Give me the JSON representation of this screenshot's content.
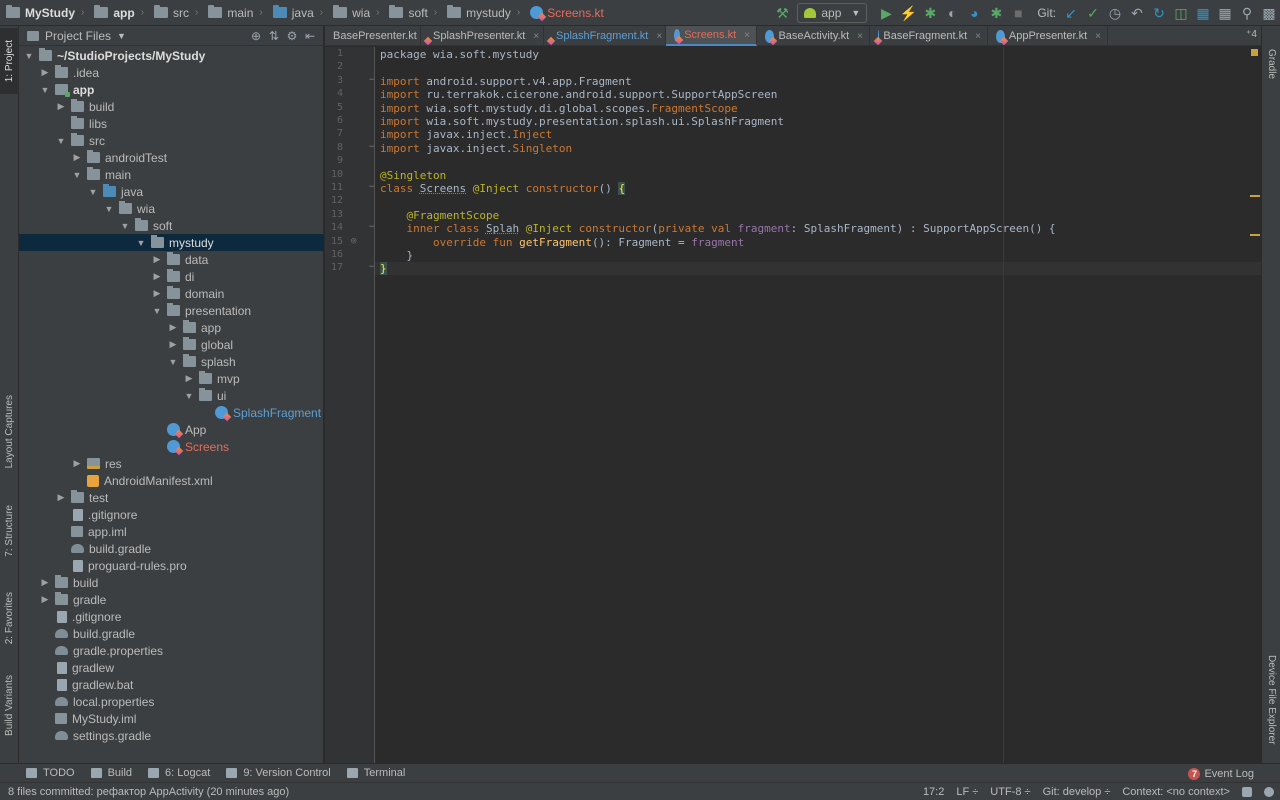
{
  "breadcrumb": [
    {
      "label": "MyStudy",
      "bold": true,
      "icon": "folder-icon"
    },
    {
      "label": "app",
      "bold": true,
      "icon": "module-folder-icon"
    },
    {
      "label": "src",
      "icon": "folder-icon"
    },
    {
      "label": "main",
      "icon": "folder-icon"
    },
    {
      "label": "java",
      "icon": "source-folder-icon"
    },
    {
      "label": "wia",
      "icon": "package-icon"
    },
    {
      "label": "soft",
      "icon": "package-icon"
    },
    {
      "label": "mystudy",
      "icon": "package-icon"
    },
    {
      "label": "Screens.kt",
      "icon": "kotlin-file-icon",
      "red": true
    }
  ],
  "toolbar": {
    "run_config": "app",
    "git_label": "Git:",
    "icons": [
      "hammer-icon",
      "run-icon",
      "lightning-icon",
      "debug-icon",
      "coverage-icon",
      "profile-icon",
      "attach-debugger-icon",
      "stop-icon",
      "git-update-icon",
      "git-commit-icon",
      "history-icon",
      "revert-icon",
      "gradle-sync-icon",
      "avd-manager-icon",
      "sdk-manager-icon",
      "project-structure-icon",
      "search-icon",
      "terminal-icon"
    ]
  },
  "left_strip": {
    "project": "1: Project",
    "layout_captures": "Layout Captures",
    "structure": "7: Structure",
    "favorites": "2: Favorites",
    "build_variants": "Build Variants"
  },
  "right_strip": {
    "gradle": "Gradle",
    "device_file_explorer": "Device File Explorer"
  },
  "project_panel": {
    "title": "Project Files",
    "tree": [
      {
        "depth": 0,
        "label": "~/StudioProjects/MyStudy",
        "arrow": "open",
        "icon": "folder",
        "style": "bold"
      },
      {
        "depth": 1,
        "label": ".idea",
        "arrow": "closed",
        "icon": "folder"
      },
      {
        "depth": 1,
        "label": "app",
        "arrow": "open",
        "icon": "folder-module",
        "style": "bold"
      },
      {
        "depth": 2,
        "label": "build",
        "arrow": "closed",
        "icon": "folder"
      },
      {
        "depth": 2,
        "label": "libs",
        "arrow": "none",
        "icon": "folder"
      },
      {
        "depth": 2,
        "label": "src",
        "arrow": "open",
        "icon": "folder"
      },
      {
        "depth": 3,
        "label": "androidTest",
        "arrow": "closed",
        "icon": "folder"
      },
      {
        "depth": 3,
        "label": "main",
        "arrow": "open",
        "icon": "folder"
      },
      {
        "depth": 4,
        "label": "java",
        "arrow": "open",
        "icon": "folder-blue"
      },
      {
        "depth": 5,
        "label": "wia",
        "arrow": "open",
        "icon": "folder"
      },
      {
        "depth": 6,
        "label": "soft",
        "arrow": "open",
        "icon": "folder"
      },
      {
        "depth": 7,
        "label": "mystudy",
        "arrow": "open",
        "icon": "folder",
        "selected": true,
        "style": "white"
      },
      {
        "depth": 8,
        "label": "data",
        "arrow": "closed",
        "icon": "folder"
      },
      {
        "depth": 8,
        "label": "di",
        "arrow": "closed",
        "icon": "folder"
      },
      {
        "depth": 8,
        "label": "domain",
        "arrow": "closed",
        "icon": "folder"
      },
      {
        "depth": 8,
        "label": "presentation",
        "arrow": "open",
        "icon": "folder"
      },
      {
        "depth": 9,
        "label": "app",
        "arrow": "closed",
        "icon": "folder"
      },
      {
        "depth": 9,
        "label": "global",
        "arrow": "closed",
        "icon": "folder"
      },
      {
        "depth": 9,
        "label": "splash",
        "arrow": "open",
        "icon": "folder"
      },
      {
        "depth": 10,
        "label": "mvp",
        "arrow": "closed",
        "icon": "folder"
      },
      {
        "depth": 10,
        "label": "ui",
        "arrow": "open",
        "icon": "folder"
      },
      {
        "depth": 11,
        "label": "SplashFragment",
        "arrow": "none",
        "icon": "kt",
        "style": "blue"
      },
      {
        "depth": 8,
        "label": "App",
        "arrow": "none",
        "icon": "kt"
      },
      {
        "depth": 8,
        "label": "Screens",
        "arrow": "none",
        "icon": "kt",
        "style": "red"
      },
      {
        "depth": 3,
        "label": "res",
        "arrow": "closed",
        "icon": "folder-res"
      },
      {
        "depth": 3,
        "label": "AndroidManifest.xml",
        "arrow": "none",
        "icon": "file-xml"
      },
      {
        "depth": 2,
        "label": "test",
        "arrow": "closed",
        "icon": "folder"
      },
      {
        "depth": 2,
        "label": ".gitignore",
        "arrow": "none",
        "icon": "file"
      },
      {
        "depth": 2,
        "label": "app.iml",
        "arrow": "none",
        "icon": "file-iml"
      },
      {
        "depth": 2,
        "label": "build.gradle",
        "arrow": "none",
        "icon": "gradle"
      },
      {
        "depth": 2,
        "label": "proguard-rules.pro",
        "arrow": "none",
        "icon": "file"
      },
      {
        "depth": 1,
        "label": "build",
        "arrow": "closed",
        "icon": "folder"
      },
      {
        "depth": 1,
        "label": "gradle",
        "arrow": "closed",
        "icon": "folder"
      },
      {
        "depth": 1,
        "label": ".gitignore",
        "arrow": "none",
        "icon": "file"
      },
      {
        "depth": 1,
        "label": "build.gradle",
        "arrow": "none",
        "icon": "gradle"
      },
      {
        "depth": 1,
        "label": "gradle.properties",
        "arrow": "none",
        "icon": "gradle"
      },
      {
        "depth": 1,
        "label": "gradlew",
        "arrow": "none",
        "icon": "file"
      },
      {
        "depth": 1,
        "label": "gradlew.bat",
        "arrow": "none",
        "icon": "file"
      },
      {
        "depth": 1,
        "label": "local.properties",
        "arrow": "none",
        "icon": "gradle"
      },
      {
        "depth": 1,
        "label": "MyStudy.iml",
        "arrow": "none",
        "icon": "file-iml"
      },
      {
        "depth": 1,
        "label": "settings.gradle",
        "arrow": "none",
        "icon": "gradle"
      }
    ]
  },
  "tabs": [
    {
      "label": "BasePresenter.kt",
      "style": "normal",
      "truncated": true
    },
    {
      "label": "SplashPresenter.kt",
      "style": "normal"
    },
    {
      "label": "SplashFragment.kt",
      "style": "blue"
    },
    {
      "label": "Screens.kt",
      "style": "red",
      "active": true
    },
    {
      "label": "BaseActivity.kt",
      "style": "normal"
    },
    {
      "label": "BaseFragment.kt",
      "style": "normal"
    },
    {
      "label": "AppPresenter.kt",
      "style": "normal"
    }
  ],
  "tabs_more": "⁺4",
  "editor": {
    "line_numbers": [
      "1",
      "2",
      "3",
      "4",
      "5",
      "6",
      "7",
      "8",
      "9",
      "10",
      "11",
      "12",
      "13",
      "14",
      "15",
      "16",
      "17"
    ],
    "lines": [
      [
        {
          "t": "package wia.soft.mystudy",
          "c": "cls"
        }
      ],
      [],
      [
        {
          "t": "import",
          "c": "kw"
        },
        {
          "t": " android.support.v4.app.Fragment",
          "c": "cls"
        }
      ],
      [
        {
          "t": "import",
          "c": "kw"
        },
        {
          "t": " ru.terrakok.cicerone.android.support.SupportAppScreen",
          "c": "cls"
        }
      ],
      [
        {
          "t": "import",
          "c": "kw"
        },
        {
          "t": " wia.soft.mystudy.di.global.scopes.",
          "c": "cls"
        },
        {
          "t": "FragmentScope",
          "c": "kw"
        }
      ],
      [
        {
          "t": "import",
          "c": "kw"
        },
        {
          "t": " wia.soft.mystudy.presentation.splash.ui.SplashFragment",
          "c": "cls"
        }
      ],
      [
        {
          "t": "import",
          "c": "kw"
        },
        {
          "t": " javax.inject.",
          "c": "cls"
        },
        {
          "t": "Inject",
          "c": "kw"
        }
      ],
      [
        {
          "t": "import",
          "c": "kw"
        },
        {
          "t": " javax.inject.",
          "c": "cls"
        },
        {
          "t": "Singleton",
          "c": "kw"
        }
      ],
      [],
      [
        {
          "t": "@Singleton",
          "c": "ann"
        }
      ],
      [
        {
          "t": "class ",
          "c": "kw"
        },
        {
          "t": "Screens",
          "c": "cls unused"
        },
        {
          "t": " ",
          "c": "cls"
        },
        {
          "t": "@Inject",
          "c": "ann"
        },
        {
          "t": " constructor",
          "c": "kw"
        },
        {
          "t": "() ",
          "c": "cls"
        },
        {
          "t": "{",
          "c": "brace-hl"
        }
      ],
      [],
      [
        {
          "t": "    ",
          "c": "cls"
        },
        {
          "t": "@FragmentScope",
          "c": "ann"
        }
      ],
      [
        {
          "t": "    inner class ",
          "c": "kw"
        },
        {
          "t": "Splah",
          "c": "cls unused"
        },
        {
          "t": " ",
          "c": "cls"
        },
        {
          "t": "@Inject",
          "c": "ann"
        },
        {
          "t": " constructor",
          "c": "kw"
        },
        {
          "t": "(",
          "c": "cls"
        },
        {
          "t": "private val ",
          "c": "kw"
        },
        {
          "t": "fragment",
          "c": "prop"
        },
        {
          "t": ": SplashFragment) : SupportAppScreen() {",
          "c": "cls"
        }
      ],
      [
        {
          "t": "        override fun ",
          "c": "kw"
        },
        {
          "t": "getFragment",
          "c": "fn"
        },
        {
          "t": "(): Fragment = ",
          "c": "cls"
        },
        {
          "t": "fragment",
          "c": "prop"
        }
      ],
      [
        {
          "t": "    }",
          "c": "cls"
        }
      ],
      [
        {
          "t": "}",
          "c": "brace-hl"
        }
      ]
    ]
  },
  "bottom_tools": [
    {
      "label": "TODO",
      "icon": "todo-icon"
    },
    {
      "label": "Build",
      "icon": "hammer-icon"
    },
    {
      "label": "6: Logcat",
      "icon": "logcat-icon"
    },
    {
      "label": "9: Version Control",
      "icon": "vcs-icon"
    },
    {
      "label": "Terminal",
      "icon": "terminal-icon"
    }
  ],
  "event_log": {
    "label": "Event Log",
    "count": "7"
  },
  "status": {
    "message": "8 files committed: рефактор AppActivity (20 minutes ago)",
    "position": "17:2",
    "line_sep": "LF ÷",
    "encoding": "UTF-8 ÷",
    "git_branch": "Git: develop ÷",
    "context": "Context: <no context>"
  }
}
